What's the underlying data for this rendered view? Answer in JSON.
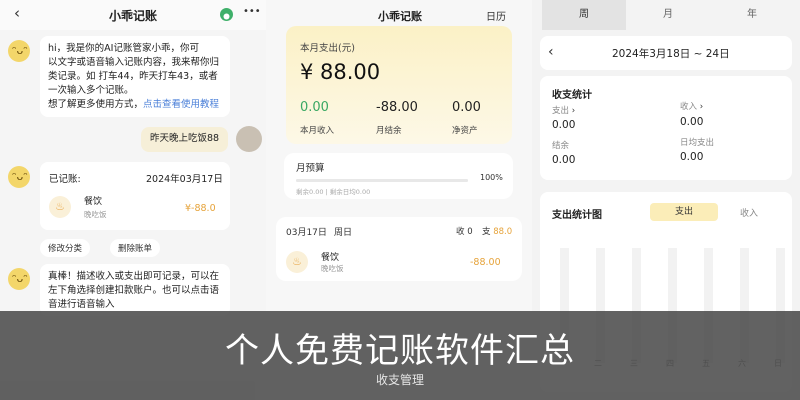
{
  "chat_screen": {
    "title": "小乖记账",
    "more_glyph": "•••",
    "welcome": {
      "line1": "hi，我是你的AI记账管家小乖，你可",
      "line2": "以文字或语音输入记账内容，我来帮你归",
      "line3": "类记录。如 打车44，昨天打车43，或者",
      "line4": "一次输入多个记账。",
      "line5_prefix": "想了解更多使用方式，",
      "line5_link": "点击查看使用教程"
    },
    "user_message": "昨天晚上吃饭88",
    "recorded_card": {
      "heading": "已记账:",
      "date": "2024年03月17日",
      "category": "餐饮",
      "note": "晚吃饭",
      "amount": "¥-88.0"
    },
    "actions": {
      "edit": "修改分类",
      "delete": "删除账单"
    },
    "praise": {
      "line1": "真棒！描述收入或支出即可记录，可以在",
      "line2": "左下角选择创建扣款账户。也可以点击语",
      "line3": "音进行语音输入"
    }
  },
  "overview_screen": {
    "title": "小乖记账",
    "calendar_link": "日历",
    "month_expense_label": "本月支出(元)",
    "month_expense_value": "¥ 88.00",
    "stats": [
      {
        "value": "0.00",
        "label": "本月收入",
        "color": "#3aa864"
      },
      {
        "value": "-88.00",
        "label": "月结余",
        "color": "#222222"
      },
      {
        "value": "0.00",
        "label": "净资产",
        "color": "#222222"
      }
    ],
    "budget": {
      "label": "月预算",
      "percent": "100%",
      "fill_fraction": 1.0,
      "remain": "剩余0.00 | 剩余日均0.00"
    },
    "day_group": {
      "date": "03月17日",
      "weekday": "周日",
      "income_label": "收",
      "income": "0",
      "expense_label": "支",
      "expense": "88.0"
    },
    "entry": {
      "category": "餐饮",
      "note": "晚吃饭",
      "amount": "-88.00"
    }
  },
  "stats_screen": {
    "tabs": [
      {
        "label": "周",
        "active": true
      },
      {
        "label": "月",
        "active": false
      },
      {
        "label": "年",
        "active": false
      }
    ],
    "date_range": "2024年3月18日  ~  24日",
    "summary": {
      "heading": "收支统计",
      "expense_label": "支出",
      "expense_value": "0.00",
      "income_label": "收入",
      "income_value": "0.00",
      "balance_label": "结余",
      "balance_value": "0.00",
      "daily_label": "日均支出",
      "daily_value": "0.00"
    },
    "chart": {
      "heading": "支出统计图",
      "toggle_expense": "支出",
      "toggle_income": "收入",
      "days": [
        "二",
        "三",
        "四",
        "五",
        "六",
        "日"
      ]
    }
  },
  "overlay": {
    "title": "个人免费记账软件汇总",
    "subtitle": "收支管理"
  }
}
